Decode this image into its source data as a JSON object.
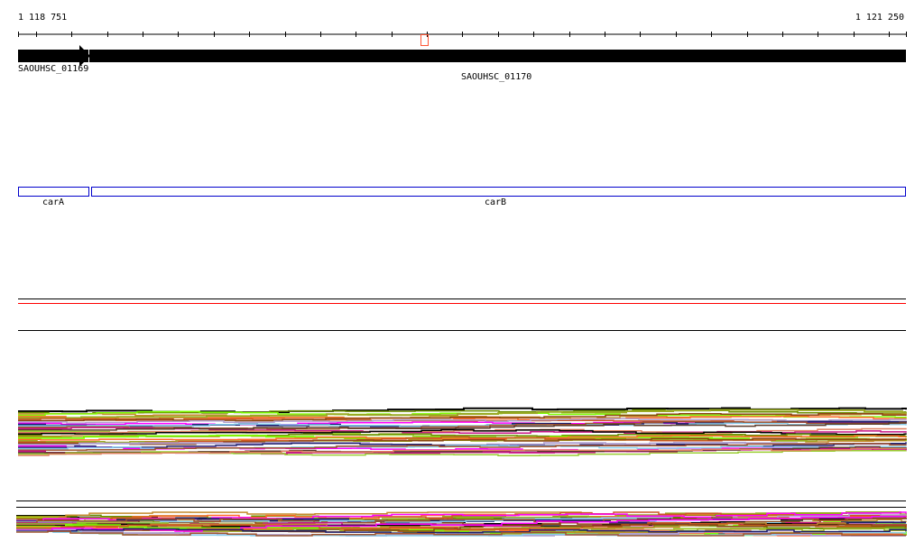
{
  "ruler": {
    "start_label": "1 118 751",
    "end_label": "1 121 250"
  },
  "genes": [
    {
      "name": "SAOUHSC_01169",
      "strand": "+"
    },
    {
      "name": "SAOUHSC_01170",
      "strand": "+"
    }
  ],
  "annotations": [
    {
      "name": "carA"
    },
    {
      "name": "carB"
    }
  ],
  "colors": {
    "gene": "#000000",
    "annotation": "#0000cc",
    "marker": "#ff5533",
    "threshold": "#ff0000",
    "palette": [
      "#000000",
      "#6b8e00",
      "#c48a2c",
      "#7cfc00",
      "#ff6a2a",
      "#99aa22",
      "#cc5522",
      "#8b4513",
      "#b0a0d0",
      "#ff00ff",
      "#1e1e6e",
      "#87ceeb",
      "#a0522d",
      "#c71585",
      "#5a3a2a",
      "#9acd32",
      "#e08060"
    ]
  }
}
